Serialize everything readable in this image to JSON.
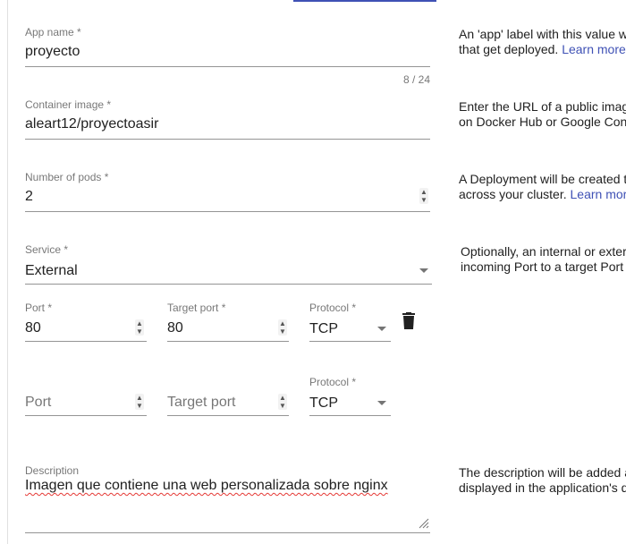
{
  "app_name": {
    "label": "App name *",
    "value": "proyecto",
    "counter": "8 / 24",
    "help": "An 'app' label with this value w",
    "help2": "that get deployed. ",
    "help_link": "Learn more"
  },
  "container_image": {
    "label": "Container image *",
    "value": "aleart12/proyectoasir",
    "help": "Enter the URL of a public imag",
    "help2": "on Docker Hub or Google Cont"
  },
  "pods": {
    "label": "Number of pods *",
    "value": "2",
    "help": "A Deployment will be created t",
    "help2": "across your cluster. ",
    "help_link": "Learn mor"
  },
  "service": {
    "label": "Service *",
    "value": "External",
    "help": "Optionally, an internal or exter",
    "help2": "incoming Port to a target Port"
  },
  "port_row_1": {
    "port_label": "Port *",
    "port_value": "80",
    "target_label": "Target port *",
    "target_value": "80",
    "protocol_label": "Protocol *",
    "protocol_value": "TCP"
  },
  "port_row_2": {
    "port_placeholder": "Port",
    "target_placeholder": "Target port",
    "protocol_label": "Protocol *",
    "protocol_value": "TCP"
  },
  "description": {
    "label": "Description",
    "value": "Imagen que contiene una web personalizada sobre nginx",
    "help": "The description will be added a",
    "help2": "displayed in the application's d"
  },
  "icons": {
    "delete": "delete-icon",
    "resize": "resize-handle-icon",
    "spinner": "spinner-arrows-icon",
    "dropdown": "dropdown-arrow-icon"
  },
  "colors": {
    "accent": "#3f51b5",
    "spellcheck": "#e53935"
  }
}
